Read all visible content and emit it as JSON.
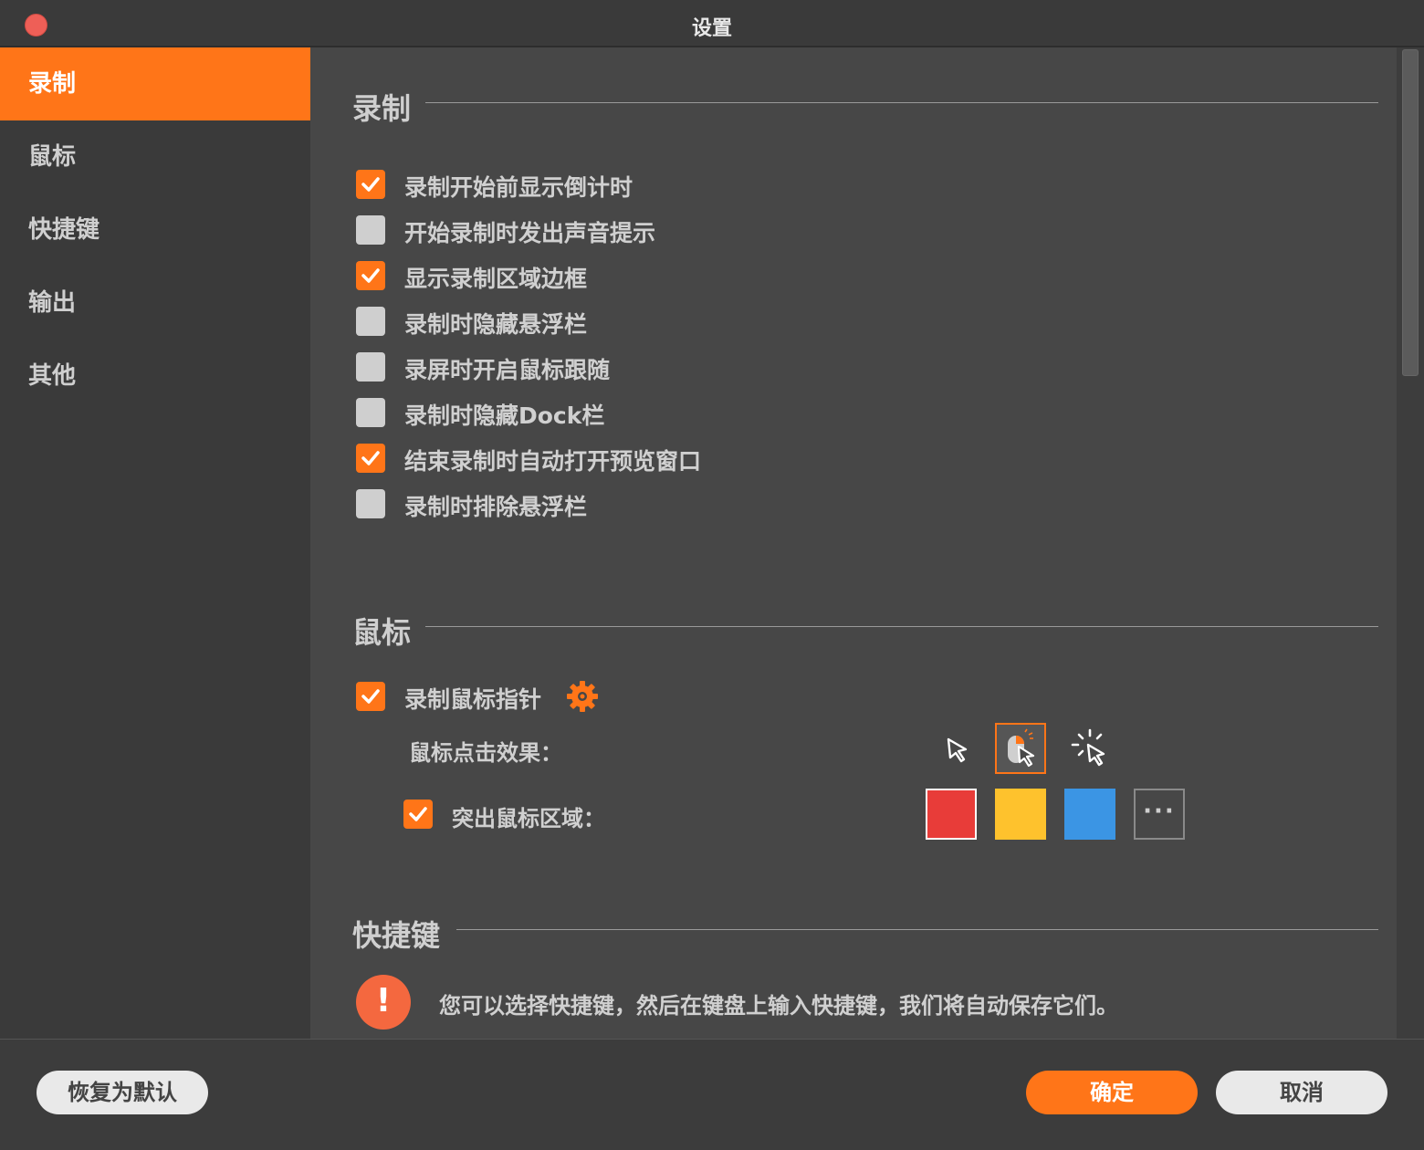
{
  "window": {
    "title": "设置"
  },
  "sidebar": {
    "items": [
      {
        "label": "录制",
        "active": true
      },
      {
        "label": "鼠标",
        "active": false
      },
      {
        "label": "快捷键",
        "active": false
      },
      {
        "label": "输出",
        "active": false
      },
      {
        "label": "其他",
        "active": false
      }
    ]
  },
  "sections": {
    "record": {
      "title": "录制",
      "options": [
        {
          "label": "录制开始前显示倒计时",
          "checked": true
        },
        {
          "label": "开始录制时发出声音提示",
          "checked": false
        },
        {
          "label": "显示录制区域边框",
          "checked": true
        },
        {
          "label": "录制时隐藏悬浮栏",
          "checked": false
        },
        {
          "label": "录屏时开启鼠标跟随",
          "checked": false
        },
        {
          "label": "录制时隐藏Dock栏",
          "checked": false
        },
        {
          "label": "结束录制时自动打开预览窗口",
          "checked": true
        },
        {
          "label": "录制时排除悬浮栏",
          "checked": false
        }
      ]
    },
    "mouse": {
      "title": "鼠标",
      "record_pointer": {
        "label": "录制鼠标指针",
        "checked": true,
        "settings_icon": "gear-icon"
      },
      "click_effect": {
        "label": "鼠标点击效果：",
        "options": [
          "plain-cursor-icon",
          "click-highlight-cursor-icon",
          "click-burst-cursor-icon"
        ],
        "selected_index": 1
      },
      "highlight_area": {
        "label": "突出鼠标区域：",
        "checked": true,
        "colors": [
          "#e83c39",
          "#fec22d",
          "#3b95e4"
        ],
        "more_label": "···"
      }
    },
    "shortcuts": {
      "title": "快捷键",
      "info": "您可以选择快捷键，然后在键盘上输入快捷键，我们将自动保存它们。",
      "info_icon": "!"
    }
  },
  "footer": {
    "reset_label": "恢复为默认",
    "ok_label": "确定",
    "cancel_label": "取消"
  },
  "colors": {
    "accent": "#ff7518",
    "warning": "#f4683f"
  }
}
